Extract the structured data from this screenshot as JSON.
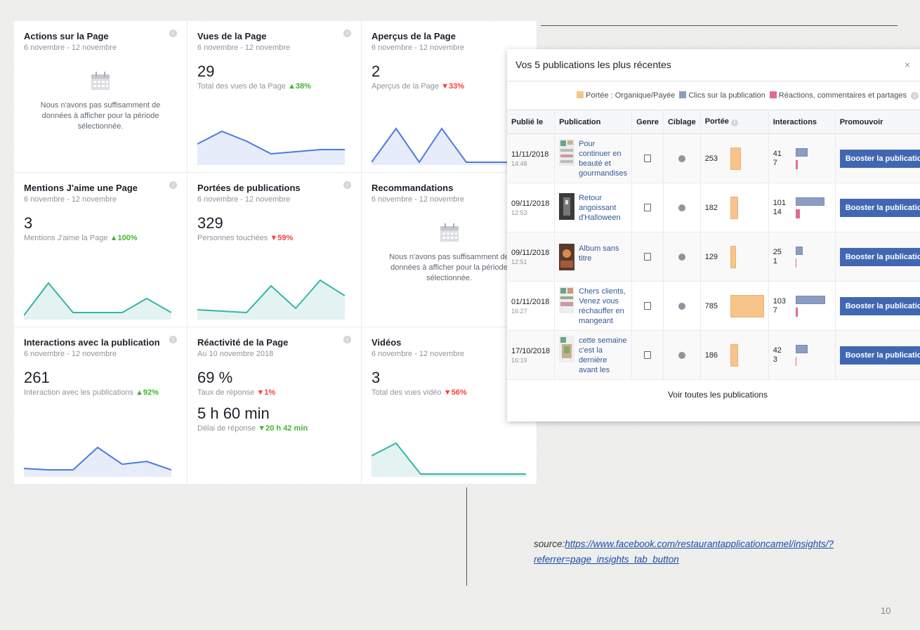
{
  "cards": [
    {
      "title": "Actions sur la Page",
      "date": "6 novembre - 12 novembre",
      "message": "Nous n'avons pas suffisamment de données à afficher pour la période sélectionnée."
    },
    {
      "title": "Vues de la Page",
      "date": "6 novembre - 12 novembre",
      "value": "29",
      "subtitle": "Total des vues de la Page",
      "change": "▲38%"
    },
    {
      "title": "Aperçus de la Page",
      "date": "6 novembre - 12 novembre",
      "value": "2",
      "subtitle": "Aperçus de la Page",
      "change": "▼33%"
    },
    {
      "title": "Mentions J'aime une Page",
      "date": "6 novembre - 12 novembre",
      "value": "3",
      "subtitle": "Mentions J'aime la Page",
      "change": "▲100%"
    },
    {
      "title": "Portées de publications",
      "date": "6 novembre - 12 novembre",
      "value": "329",
      "subtitle": "Personnes touchées",
      "change": "▼59%"
    },
    {
      "title": "Recommandations",
      "date": "6 novembre - 12 novembre",
      "message": "Nous n'avons pas suffisamment de données à afficher pour la période sélectionnée."
    },
    {
      "title": "Interactions avec la publication",
      "date": "6 novembre - 12 novembre",
      "value": "261",
      "subtitle": "Interaction avec les publications",
      "change": "▲92%"
    },
    {
      "title": "Réactivité de la Page",
      "date": "Au 10 novembre 2018",
      "value": "69 %",
      "subtitle": "Taux de réponse",
      "change": "▼1%",
      "value2": "5 h 60 min",
      "subtitle2": "Délai de réponse",
      "change2": "▼20 h 42 min"
    },
    {
      "title": "Vidéos",
      "date": "6 novembre - 12 novembre",
      "value": "3",
      "subtitle": "Total des vues vidéo",
      "change": "▼56%"
    }
  ],
  "panel": {
    "title": "Vos 5 publications les plus récentes",
    "close": "×",
    "legend": [
      {
        "label": "Portée : Organique/Payée",
        "color": "#f7c48a"
      },
      {
        "label": "Clics sur la publication",
        "color": "#8b9dc3"
      },
      {
        "label": "Réactions, commentaires et partages",
        "color": "#e26b89"
      }
    ],
    "columns": [
      "Publié le",
      "Publication",
      "Genre",
      "Ciblage",
      "Portée",
      "Interactions",
      "Promouvoir"
    ],
    "rows": [
      {
        "date": "11/11/2018",
        "time": "14:48",
        "text": "Pour continuer en beauté et gourmandises",
        "reach": "253",
        "clicks": "41",
        "reactions": "7",
        "button": "Booster la publication"
      },
      {
        "date": "09/11/2018",
        "time": "12:53",
        "text": "Retour angoissant d'Halloween",
        "reach": "182",
        "clicks": "101",
        "reactions": "14",
        "button": "Booster la publication"
      },
      {
        "date": "09/11/2018",
        "time": "12:51",
        "text": "Album sans titre",
        "reach": "129",
        "clicks": "25",
        "reactions": "1",
        "button": "Booster la publication"
      },
      {
        "date": "01/11/2018",
        "time": "16:27",
        "text": "Chers clients, Venez vous réchauffer en mangeant",
        "reach": "785",
        "clicks": "103",
        "reactions": "7",
        "button": "Booster la publication"
      },
      {
        "date": "17/10/2018",
        "time": "16:19",
        "text": "cette semaine c'est la dernière avant les",
        "reach": "186",
        "clicks": "42",
        "reactions": "3",
        "button": "Booster la publication"
      }
    ],
    "footer": "Voir toutes les publications"
  },
  "source": {
    "prefix": "source:",
    "link": "https://www.facebook.com/restaurantapplicationcamel/insights/?referrer=page_insights_tab_button"
  },
  "page_number": "10"
}
